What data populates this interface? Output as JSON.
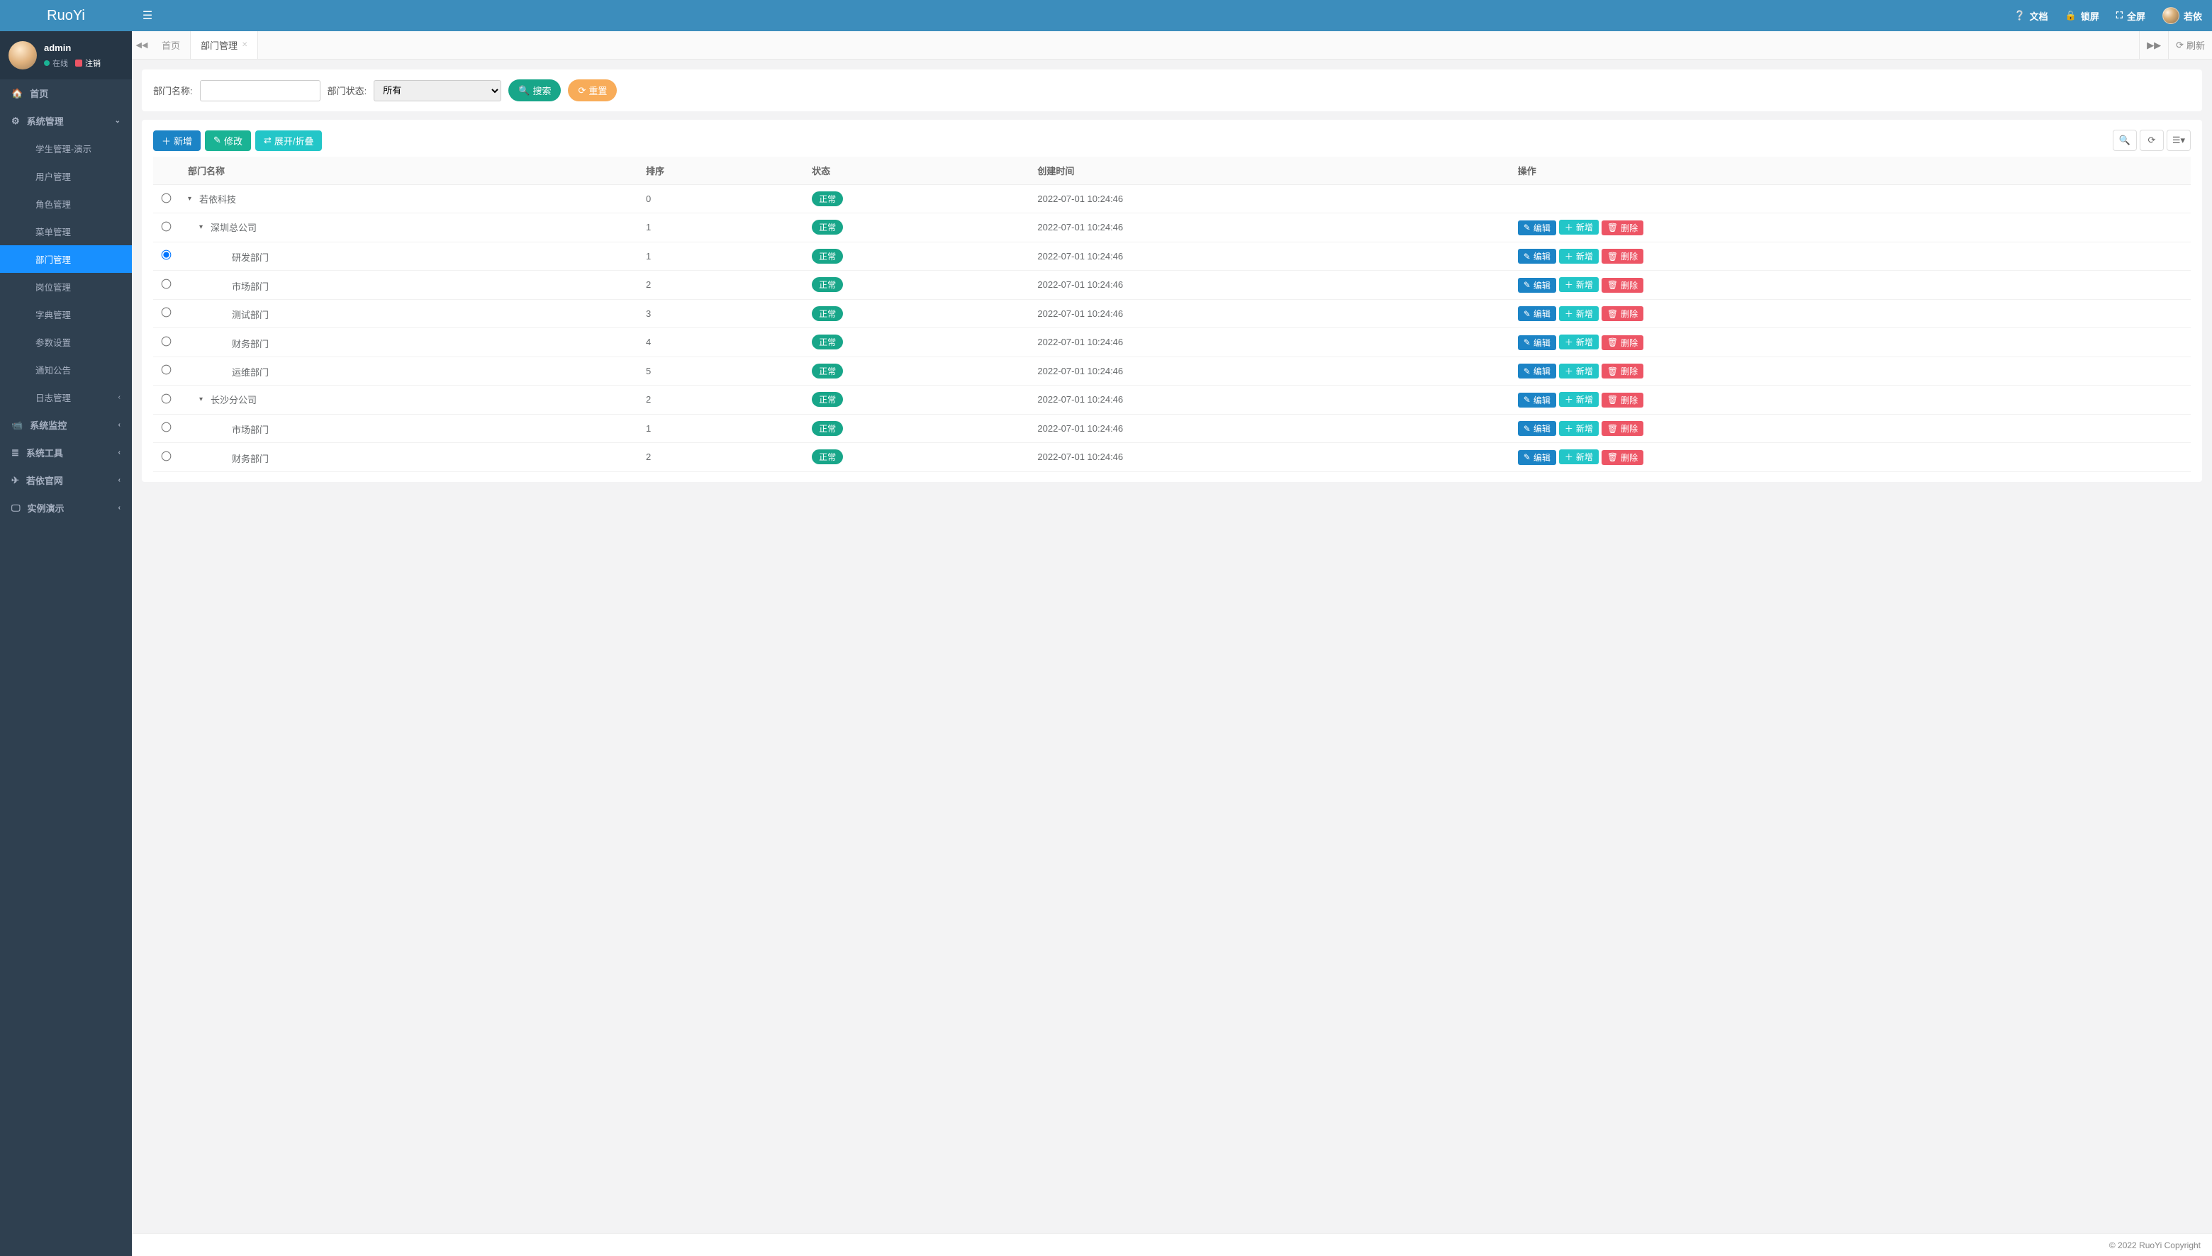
{
  "brand": "RuoYi",
  "header": {
    "doc": "文档",
    "lock": "锁屏",
    "fullscreen": "全屏",
    "username": "若依"
  },
  "sidebar": {
    "user": {
      "name": "admin",
      "online": "在线",
      "logout": "注销"
    },
    "home": "首页",
    "groups": [
      {
        "label": "系统管理",
        "expanded": true,
        "items": [
          {
            "label": "学生管理-演示",
            "active": false
          },
          {
            "label": "用户管理",
            "active": false
          },
          {
            "label": "角色管理",
            "active": false
          },
          {
            "label": "菜单管理",
            "active": false
          },
          {
            "label": "部门管理",
            "active": true
          },
          {
            "label": "岗位管理",
            "active": false
          },
          {
            "label": "字典管理",
            "active": false
          },
          {
            "label": "参数设置",
            "active": false
          },
          {
            "label": "通知公告",
            "active": false
          },
          {
            "label": "日志管理",
            "active": false,
            "caret": true
          }
        ]
      },
      {
        "label": "系统监控",
        "expanded": false
      },
      {
        "label": "系统工具",
        "expanded": false
      },
      {
        "label": "若依官网",
        "expanded": false
      },
      {
        "label": "实例演示",
        "expanded": false
      }
    ]
  },
  "tabs": {
    "items": [
      {
        "label": "首页",
        "active": false,
        "closable": false
      },
      {
        "label": "部门管理",
        "active": true,
        "closable": true
      }
    ],
    "refresh": "刷新"
  },
  "search": {
    "deptname_label": "部门名称:",
    "deptname_value": "",
    "status_label": "部门状态:",
    "status_value": "所有",
    "search_btn": "搜索",
    "reset_btn": "重置"
  },
  "toolbar": {
    "add": "新增",
    "edit": "修改",
    "expand": "展开/折叠"
  },
  "table": {
    "cols": {
      "name": "部门名称",
      "order": "排序",
      "status": "状态",
      "created": "创建时间",
      "ops": "操作"
    },
    "op_labels": {
      "edit": "编辑",
      "add": "新增",
      "del": "删除"
    },
    "status_ok": "正常",
    "rows": [
      {
        "name": "若依科技",
        "indent": 0,
        "hasChildren": true,
        "order": "0",
        "created": "2022-07-01 10:24:46",
        "selected": false,
        "ops": false
      },
      {
        "name": "深圳总公司",
        "indent": 1,
        "hasChildren": true,
        "order": "1",
        "created": "2022-07-01 10:24:46",
        "selected": false,
        "ops": true
      },
      {
        "name": "研发部门",
        "indent": 2,
        "hasChildren": false,
        "order": "1",
        "created": "2022-07-01 10:24:46",
        "selected": true,
        "ops": true
      },
      {
        "name": "市场部门",
        "indent": 2,
        "hasChildren": false,
        "order": "2",
        "created": "2022-07-01 10:24:46",
        "selected": false,
        "ops": true
      },
      {
        "name": "测试部门",
        "indent": 2,
        "hasChildren": false,
        "order": "3",
        "created": "2022-07-01 10:24:46",
        "selected": false,
        "ops": true
      },
      {
        "name": "财务部门",
        "indent": 2,
        "hasChildren": false,
        "order": "4",
        "created": "2022-07-01 10:24:46",
        "selected": false,
        "ops": true
      },
      {
        "name": "运维部门",
        "indent": 2,
        "hasChildren": false,
        "order": "5",
        "created": "2022-07-01 10:24:46",
        "selected": false,
        "ops": true
      },
      {
        "name": "长沙分公司",
        "indent": 1,
        "hasChildren": true,
        "order": "2",
        "created": "2022-07-01 10:24:46",
        "selected": false,
        "ops": true
      },
      {
        "name": "市场部门",
        "indent": 2,
        "hasChildren": false,
        "order": "1",
        "created": "2022-07-01 10:24:46",
        "selected": false,
        "ops": true
      },
      {
        "name": "财务部门",
        "indent": 2,
        "hasChildren": false,
        "order": "2",
        "created": "2022-07-01 10:24:46",
        "selected": false,
        "ops": true
      }
    ]
  },
  "footer": {
    "copyright": "© 2022 RuoYi Copyright"
  }
}
